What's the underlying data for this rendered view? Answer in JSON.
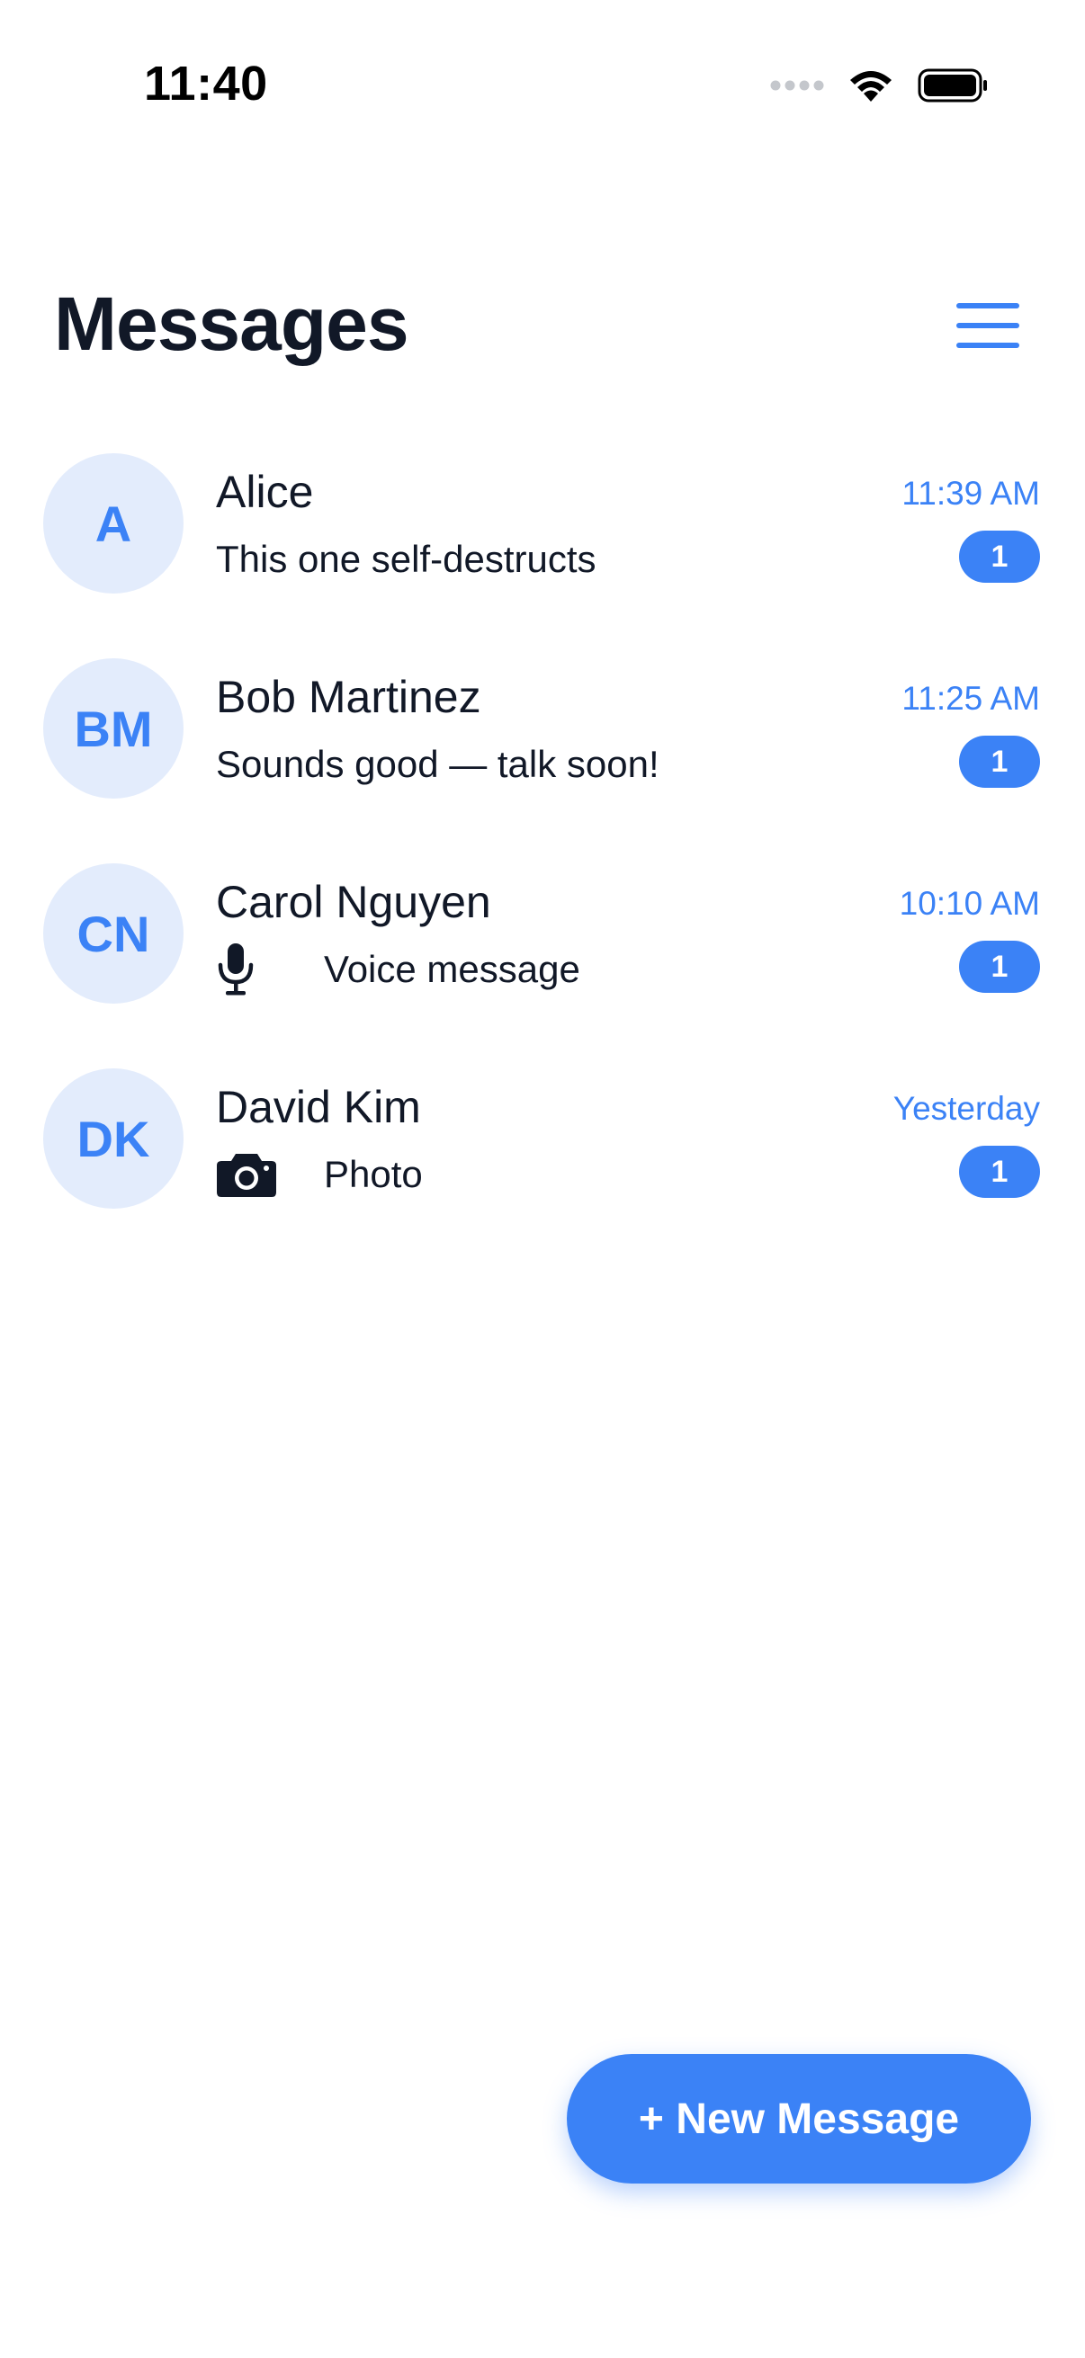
{
  "status_bar": {
    "time": "11:40",
    "icons": [
      "signal-dots-icon",
      "wifi-icon",
      "battery-icon"
    ]
  },
  "header": {
    "title": "Messages",
    "menu_icon": "hamburger-menu-icon"
  },
  "colors": {
    "accent": "#3b82f6",
    "avatar_bg": "#e3ecfc",
    "text": "#111827"
  },
  "conversations": [
    {
      "initials": "A",
      "name": "Alice",
      "preview": "This one self-destructs",
      "preview_icon": null,
      "timestamp": "11:39 AM",
      "unread": "1"
    },
    {
      "initials": "BM",
      "name": "Bob Martinez",
      "preview": "Sounds good — talk soon!",
      "preview_icon": null,
      "timestamp": "11:25 AM",
      "unread": "1"
    },
    {
      "initials": "CN",
      "name": "Carol Nguyen",
      "preview": "Voice message",
      "preview_icon": "microphone-icon",
      "timestamp": "10:10 AM",
      "unread": "1"
    },
    {
      "initials": "DK",
      "name": "David Kim",
      "preview": "Photo",
      "preview_icon": "camera-icon",
      "timestamp": "Yesterday",
      "unread": "1"
    }
  ],
  "fab": {
    "label": "+ New Message"
  }
}
